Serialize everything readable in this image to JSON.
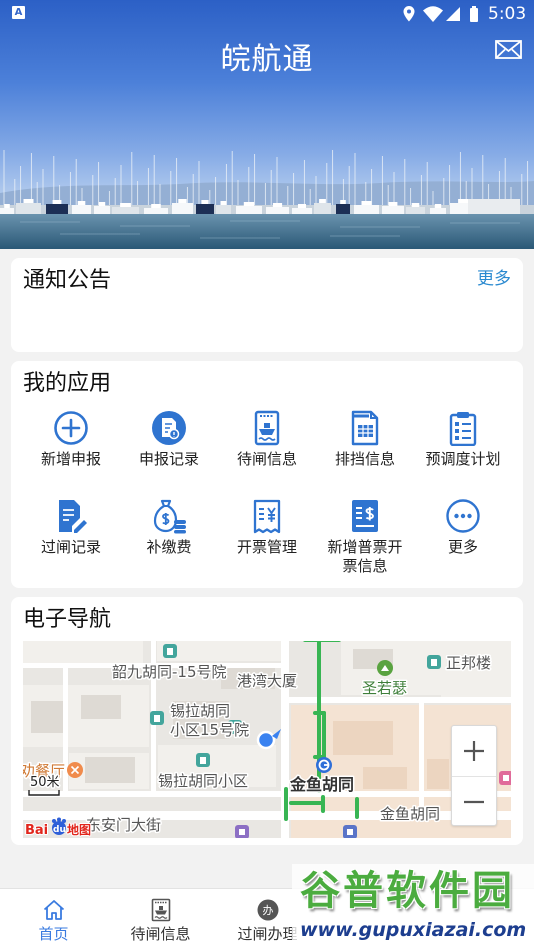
{
  "status_bar": {
    "notification_icon_text": "A",
    "time": "5:03",
    "icons": [
      "location-icon",
      "wifi-icon",
      "signal-icon",
      "battery-icon"
    ]
  },
  "header": {
    "title": "皖航通",
    "action_icon": "mail-icon"
  },
  "notice_card": {
    "title": "通知公告",
    "more_link": "更多"
  },
  "apps_card": {
    "title": "我的应用",
    "items": [
      {
        "label": "新增申报",
        "icon": "plus-circle-icon"
      },
      {
        "label": "申报记录",
        "icon": "document-record-icon"
      },
      {
        "label": "待闸信息",
        "icon": "ship-document-icon"
      },
      {
        "label": "排挡信息",
        "icon": "grid-document-icon"
      },
      {
        "label": "预调度计划",
        "icon": "clipboard-list-icon"
      },
      {
        "label": "过闸记录",
        "icon": "document-pen-icon"
      },
      {
        "label": "补缴费",
        "icon": "money-bag-icon"
      },
      {
        "label": "开票管理",
        "icon": "receipt-icon"
      },
      {
        "label": "新增普票开票信息",
        "icon": "invoice-dollar-icon"
      },
      {
        "label": "更多",
        "icon": "more-dots-icon"
      }
    ]
  },
  "navigation_card": {
    "title": "电子导航",
    "map": {
      "labels": {
        "shaojiu": "韶九胡同-15号院",
        "gangwan": "港湾大厦",
        "zhengbang": "正邦楼",
        "shengruose": "圣若瑟",
        "xila_line1": "锡拉胡同",
        "xila_line2": "小区15号院",
        "restaurant": "劝餐厅",
        "xila_community": "锡拉胡同小区",
        "jinyu_station": "金鱼胡同",
        "jinyu_street": "金鱼胡同",
        "dongan_street": "东安门大街"
      },
      "scale": "50米",
      "logo": {
        "bai": "Bai",
        "du": "du",
        "map": "地图"
      },
      "controls": [
        "zoom-in-icon",
        "zoom-out-icon"
      ]
    }
  },
  "tab_bar": {
    "items": [
      {
        "label": "首页",
        "icon": "home-icon",
        "active": true
      },
      {
        "label": "待闸信息",
        "icon": "ship-frame-icon",
        "active": false
      },
      {
        "label": "过闸办理",
        "icon": "process-badge-icon",
        "icon_text": "办",
        "active": false
      }
    ]
  },
  "watermark": {
    "title": "谷普软件园",
    "url": "www.gupuxiazai.com"
  },
  "colors": {
    "icon_blue": "#2f74d0",
    "link": "#2b8ad0",
    "tab_active": "#3a7be0",
    "background": "#f2f2f2",
    "card": "#ffffff",
    "map_route": "#38b553"
  }
}
